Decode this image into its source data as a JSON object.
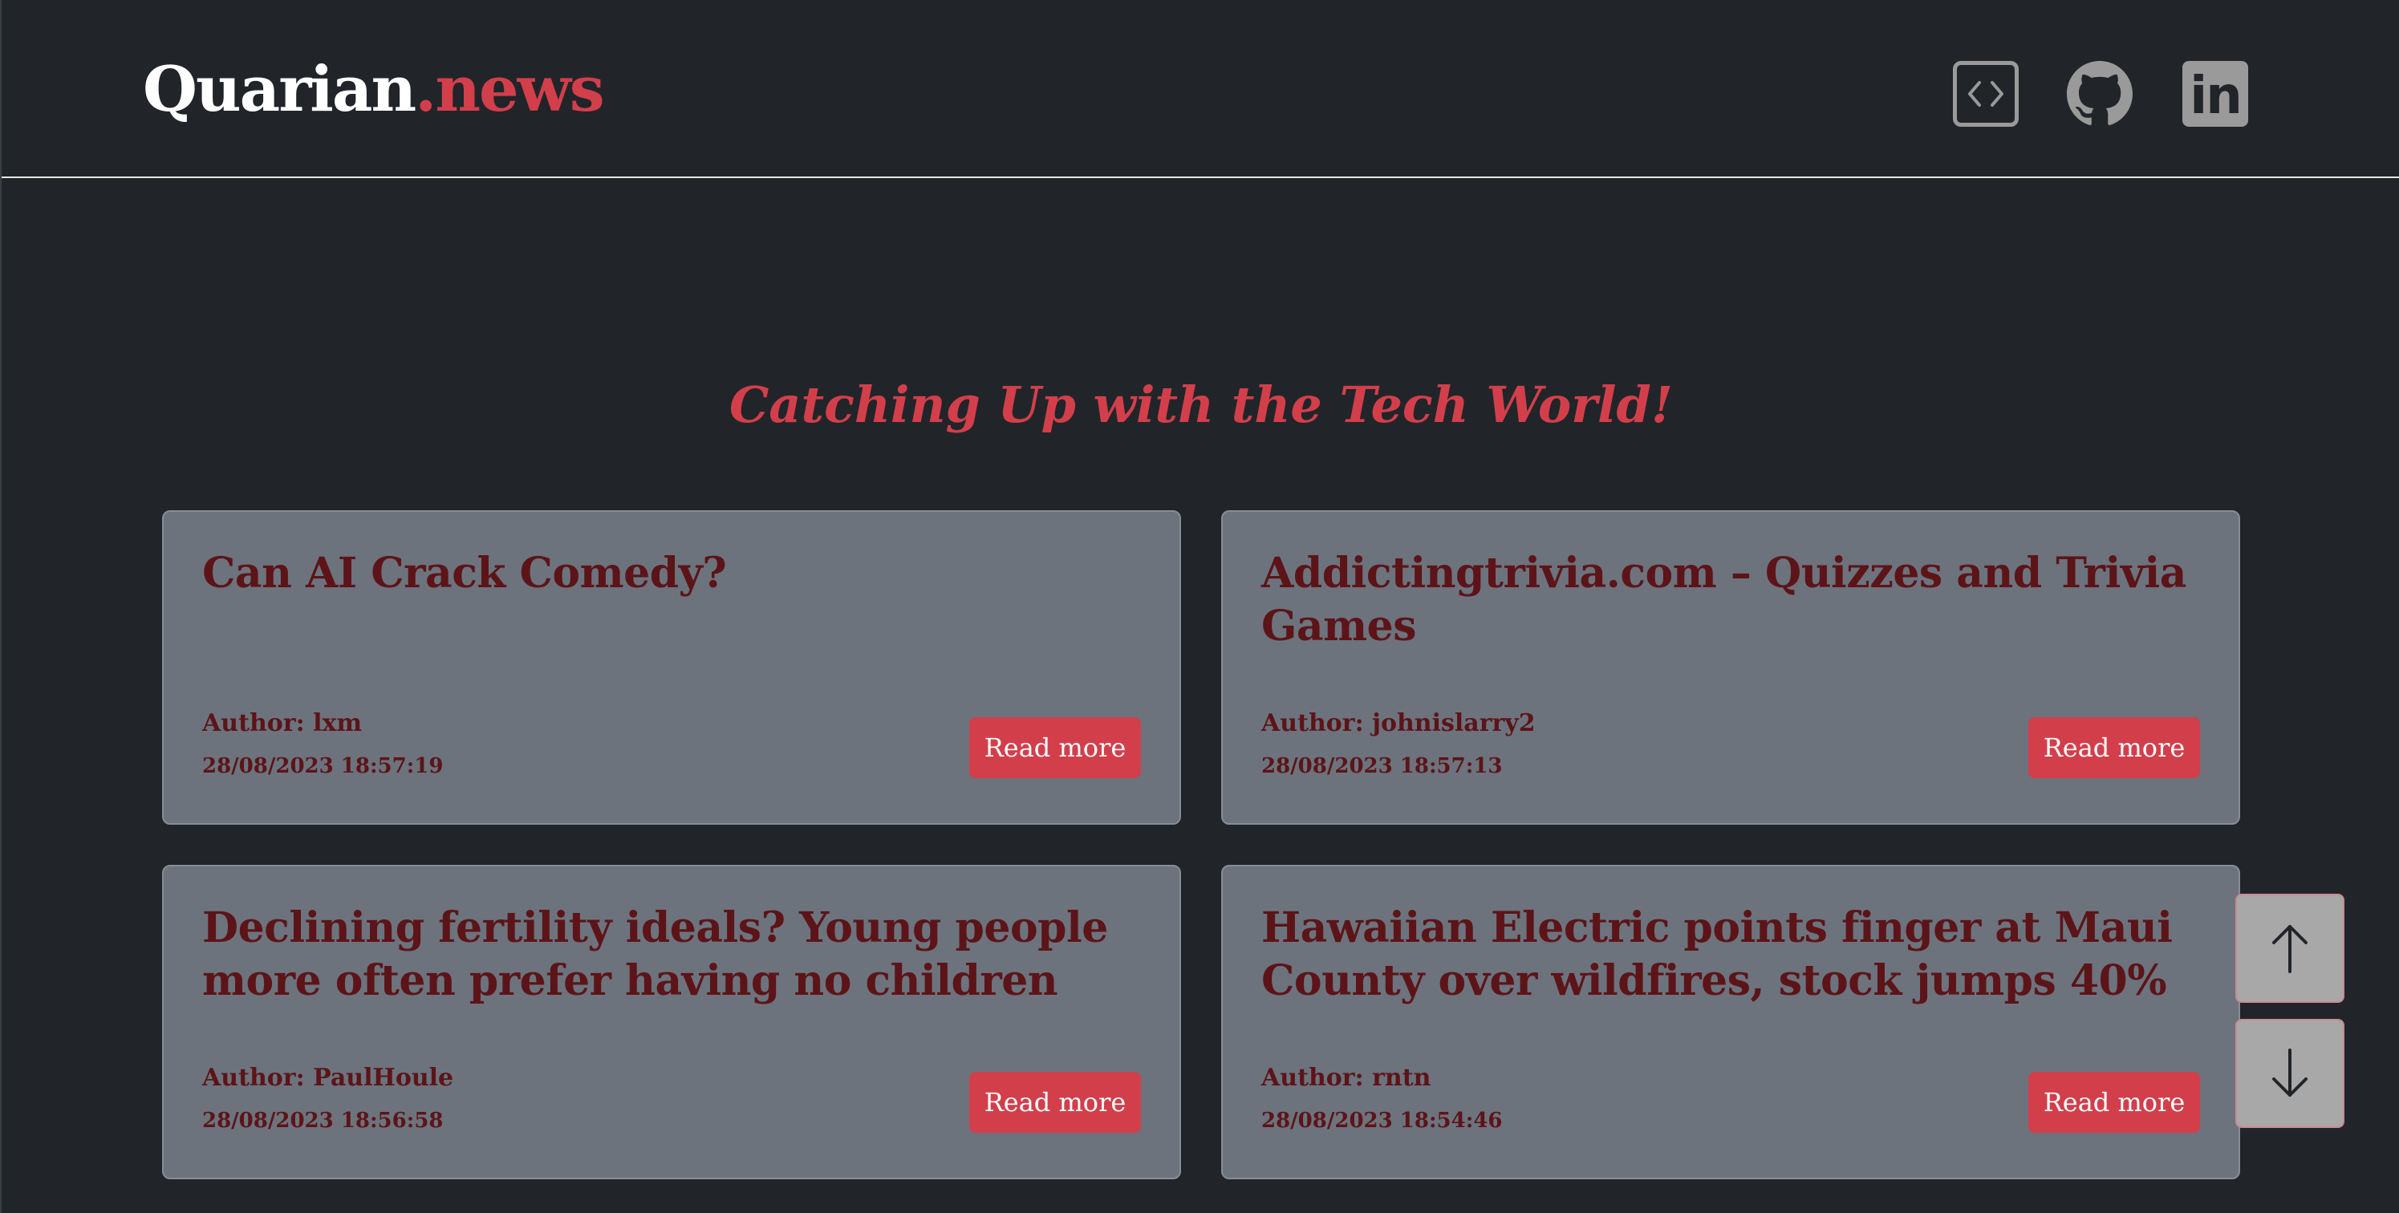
{
  "header": {
    "brand_main": "Quarian",
    "brand_accent": ".news",
    "icons": [
      "code-icon",
      "github-icon",
      "linkedin-icon"
    ],
    "linkedin_glyph": "in"
  },
  "tagline": "Catching Up with the Tech World!",
  "cards": [
    {
      "title": "Can AI Crack Comedy?",
      "author": "Author: lxm",
      "date": "28/08/2023 18:57:19",
      "button": "Read more"
    },
    {
      "title": "Addictingtrivia.com – Quizzes and Trivia Games",
      "author": "Author: johnislarry2",
      "date": "28/08/2023 18:57:13",
      "button": "Read more"
    },
    {
      "title": "Declining fertility ideals? Young people more often prefer having no children",
      "author": "Author: PaulHoule",
      "date": "28/08/2023 18:56:58",
      "button": "Read more"
    },
    {
      "title": "Hawaiian Electric points finger at Maui County over wildfires, stock jumps 40%",
      "author": "Author: rntn",
      "date": "28/08/2023 18:54:46",
      "button": "Read more"
    }
  ],
  "scroll": {
    "up_icon": "arrow-up-icon",
    "down_icon": "arrow-down-icon"
  },
  "colors": {
    "background": "#212529",
    "accent": "#d23f4b",
    "card": "#6c737d",
    "card_text": "#5c1418",
    "icon": "#9a9a9a"
  }
}
